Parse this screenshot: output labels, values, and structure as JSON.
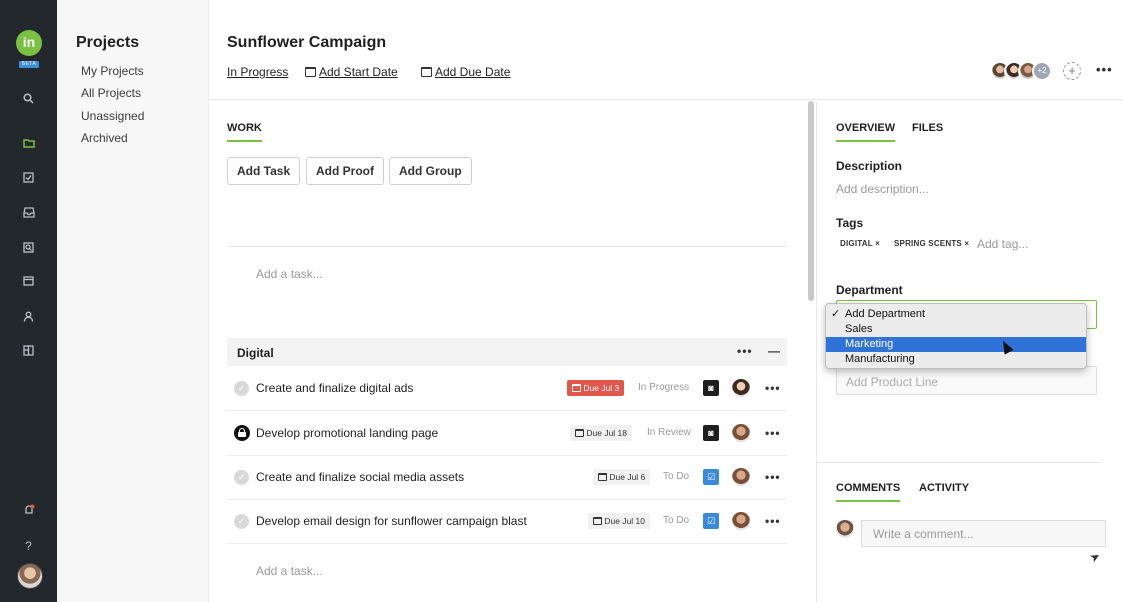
{
  "rail": {
    "logo": "in",
    "beta": "BETA",
    "icons": [
      "search-icon",
      "folder-icon",
      "checkbox-icon",
      "inbox-icon",
      "proof-icon",
      "calendar-icon",
      "person-icon",
      "layout-icon",
      "notification-icon",
      "help-icon"
    ],
    "active_icon": "folder-icon",
    "accent": "#7ac143"
  },
  "projects_panel": {
    "title": "Projects",
    "items": [
      "My Projects",
      "All Projects",
      "Unassigned",
      "Archived"
    ]
  },
  "header": {
    "title": "Sunflower Campaign",
    "status": "In Progress",
    "start_date": "Add Start Date",
    "due_date": "Add Due Date",
    "extra_members": "+2",
    "more": "•••"
  },
  "work": {
    "tab": "WORK",
    "buttons": [
      "Add Task",
      "Add Proof",
      "Add Group"
    ],
    "add_task_placeholder": "Add a task...",
    "group": {
      "name": "Digital",
      "more": "•••",
      "collapse": "—",
      "tasks": [
        {
          "name": "Create and finalize digital ads",
          "due": "Due Jul 3",
          "overdue": true,
          "status": "In Progress",
          "proof_icon": "proof-icon",
          "more": "•••"
        },
        {
          "name": "Develop promotional landing page",
          "due": "Due Jul 18",
          "overdue": false,
          "status": "In Review",
          "proof_icon": "proof-icon",
          "more": "•••"
        },
        {
          "name": "Create and finalize social media assets",
          "due": "Due Jul 6",
          "overdue": false,
          "status": "To Do",
          "proof_icon": "checkbox-icon",
          "more": "•••"
        },
        {
          "name": "Develop email design for sunflower campaign blast",
          "due": "Due Jul 10",
          "overdue": false,
          "status": "To Do",
          "proof_icon": "checkbox-icon",
          "more": "•••"
        }
      ],
      "add_task_placeholder": "Add a task..."
    }
  },
  "details": {
    "tabs": [
      "OVERVIEW",
      "FILES"
    ],
    "description_label": "Description",
    "description_placeholder": "Add description...",
    "tags_label": "Tags",
    "tags": [
      "DIGITAL",
      "SPRING SCENTS"
    ],
    "tag_placeholder": "Add tag...",
    "department_label": "Department",
    "department_options": [
      "Add Department",
      "Sales",
      "Marketing",
      "Manufacturing"
    ],
    "department_selected": "Add Department",
    "department_highlighted": "Marketing",
    "product_line_placeholder": "Add Product Line",
    "comment_tabs": [
      "COMMENTS",
      "ACTIVITY"
    ],
    "comment_placeholder": "Write a comment..."
  },
  "colors": {
    "overdue": "#e2574c",
    "proof_blue": "#3b8ad9",
    "menu_highlight": "#2f73d8"
  }
}
